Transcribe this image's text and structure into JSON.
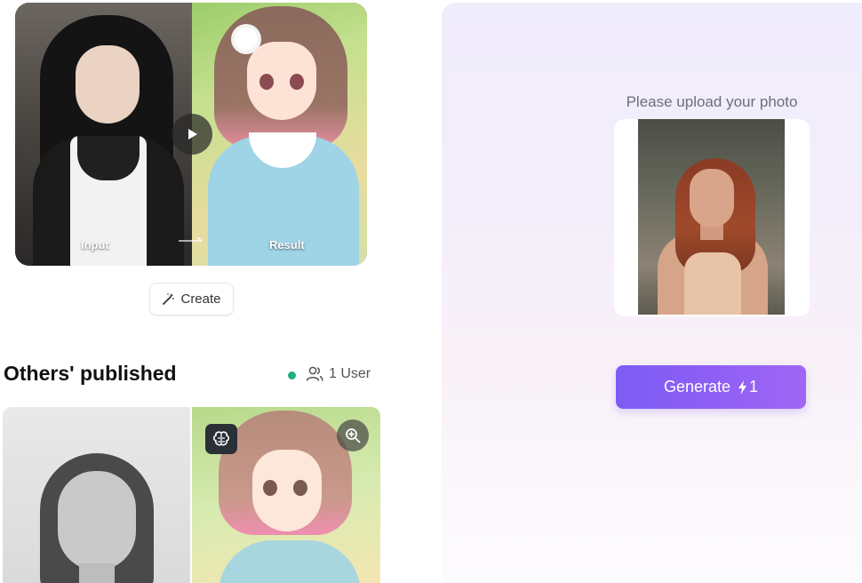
{
  "demo": {
    "input_label": "Input",
    "result_label": "Result"
  },
  "create_button": {
    "label": "Create"
  },
  "published": {
    "title": "Others' published",
    "user_count": "1 User",
    "status_color": "#22b07d"
  },
  "panel": {
    "upload_label": "Please upload your photo",
    "generate": {
      "label": "Generate",
      "cost": "1"
    },
    "accent_color": "#8e5ff5"
  },
  "icons": {
    "play": "play-icon",
    "arrow": "arrow-right-icon",
    "create": "magic-wand-icon",
    "users": "users-icon",
    "brain": "brain-icon",
    "zoom": "zoom-in-icon",
    "lightning": "lightning-icon"
  }
}
